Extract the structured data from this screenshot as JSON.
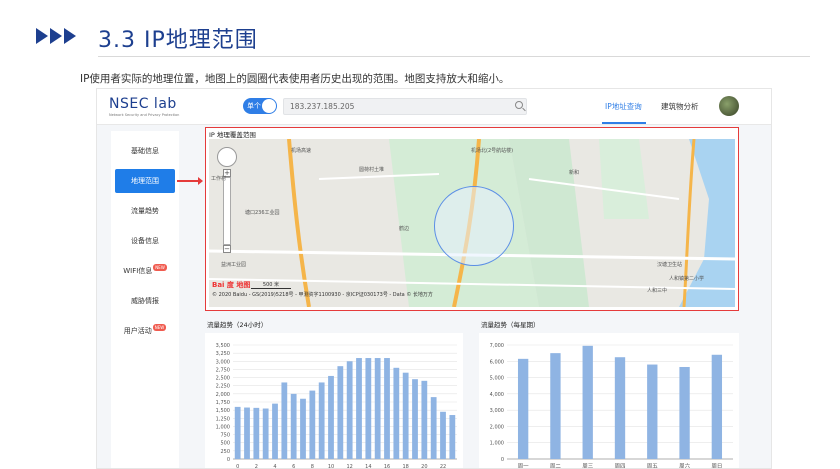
{
  "slide": {
    "title": "3.3 IP地理范围",
    "description": "IP使用者实际的地理位置，地图上的圆圈代表使用者历史出现的范围。地图支持放大和缩小。"
  },
  "topbar": {
    "logo": "NSEC lab",
    "logo_sub": "Network Security and Privacy Protection",
    "toggle_label": "单个",
    "search_value": "183.237.185.205",
    "tabs": [
      {
        "label": "IP地址查询",
        "active": true
      },
      {
        "label": "建筑物分析",
        "active": false
      }
    ]
  },
  "sidebar": {
    "items": [
      {
        "label": "基础信息",
        "badge": ""
      },
      {
        "label": "地理范围",
        "badge": "",
        "active": true
      },
      {
        "label": "流量趋势",
        "badge": ""
      },
      {
        "label": "设备信息",
        "badge": ""
      },
      {
        "label": "WIFI信息",
        "badge": "NEW"
      },
      {
        "label": "威胁情报",
        "badge": ""
      },
      {
        "label": "用户活动",
        "badge": "NEW"
      }
    ]
  },
  "map": {
    "title": "IP 地理覆盖范围",
    "labels": {
      "l1": "机场北(2号航站楼)",
      "l2": "圆荷村土堆",
      "l3": "塘口236工业园",
      "l4": "益洲工业园",
      "l5": "人和三中",
      "l6": "汉塘卫生站",
      "l7": "人和镇第二小学",
      "l8": "工作村",
      "l9": "机场高速",
      "l10": "新和",
      "l11": "鹤边"
    },
    "scale": "500 米",
    "baidu": "Bai 度 地图",
    "footer": "© 2020 Baidu - GS(2019)5218号 - 甲测资字1100930 - 京ICP证030173号 - Data © 长地万方"
  },
  "chart_data": [
    {
      "type": "bar",
      "title": "流量趋势（24小时）",
      "x": [
        0,
        1,
        2,
        3,
        4,
        5,
        6,
        7,
        8,
        9,
        10,
        11,
        12,
        13,
        14,
        15,
        16,
        17,
        18,
        19,
        20,
        21,
        22,
        23
      ],
      "x_ticks": [
        "0",
        "2",
        "4",
        "6",
        "8",
        "10",
        "12",
        "14",
        "16",
        "18",
        "20",
        "22"
      ],
      "values": [
        1600,
        1580,
        1570,
        1550,
        1700,
        2350,
        2000,
        1850,
        2100,
        2350,
        2550,
        2850,
        3000,
        3100,
        3100,
        3100,
        3100,
        2800,
        2650,
        2450,
        2400,
        1900,
        1450,
        1350
      ],
      "ylim": [
        0,
        3500
      ],
      "y_ticks": [
        "0",
        "250",
        "500",
        "750",
        "1,000",
        "1,250",
        "1,500",
        "1,750",
        "2,000",
        "2,250",
        "2,500",
        "2,750",
        "3,000",
        "3,250",
        "3,500"
      ],
      "grid": true,
      "color": "#8fb4e3"
    },
    {
      "type": "bar",
      "title": "流量趋势（每星期）",
      "categories": [
        "周一",
        "周二",
        "周三",
        "周四",
        "周五",
        "周六",
        "周日"
      ],
      "values": [
        6150,
        6500,
        6950,
        6250,
        5800,
        5650,
        6400
      ],
      "ylim": [
        0,
        7000
      ],
      "y_ticks": [
        "0",
        "1,000",
        "2,000",
        "3,000",
        "4,000",
        "5,000",
        "6,000",
        "7,000"
      ],
      "grid": true,
      "color": "#8fb4e3"
    }
  ]
}
